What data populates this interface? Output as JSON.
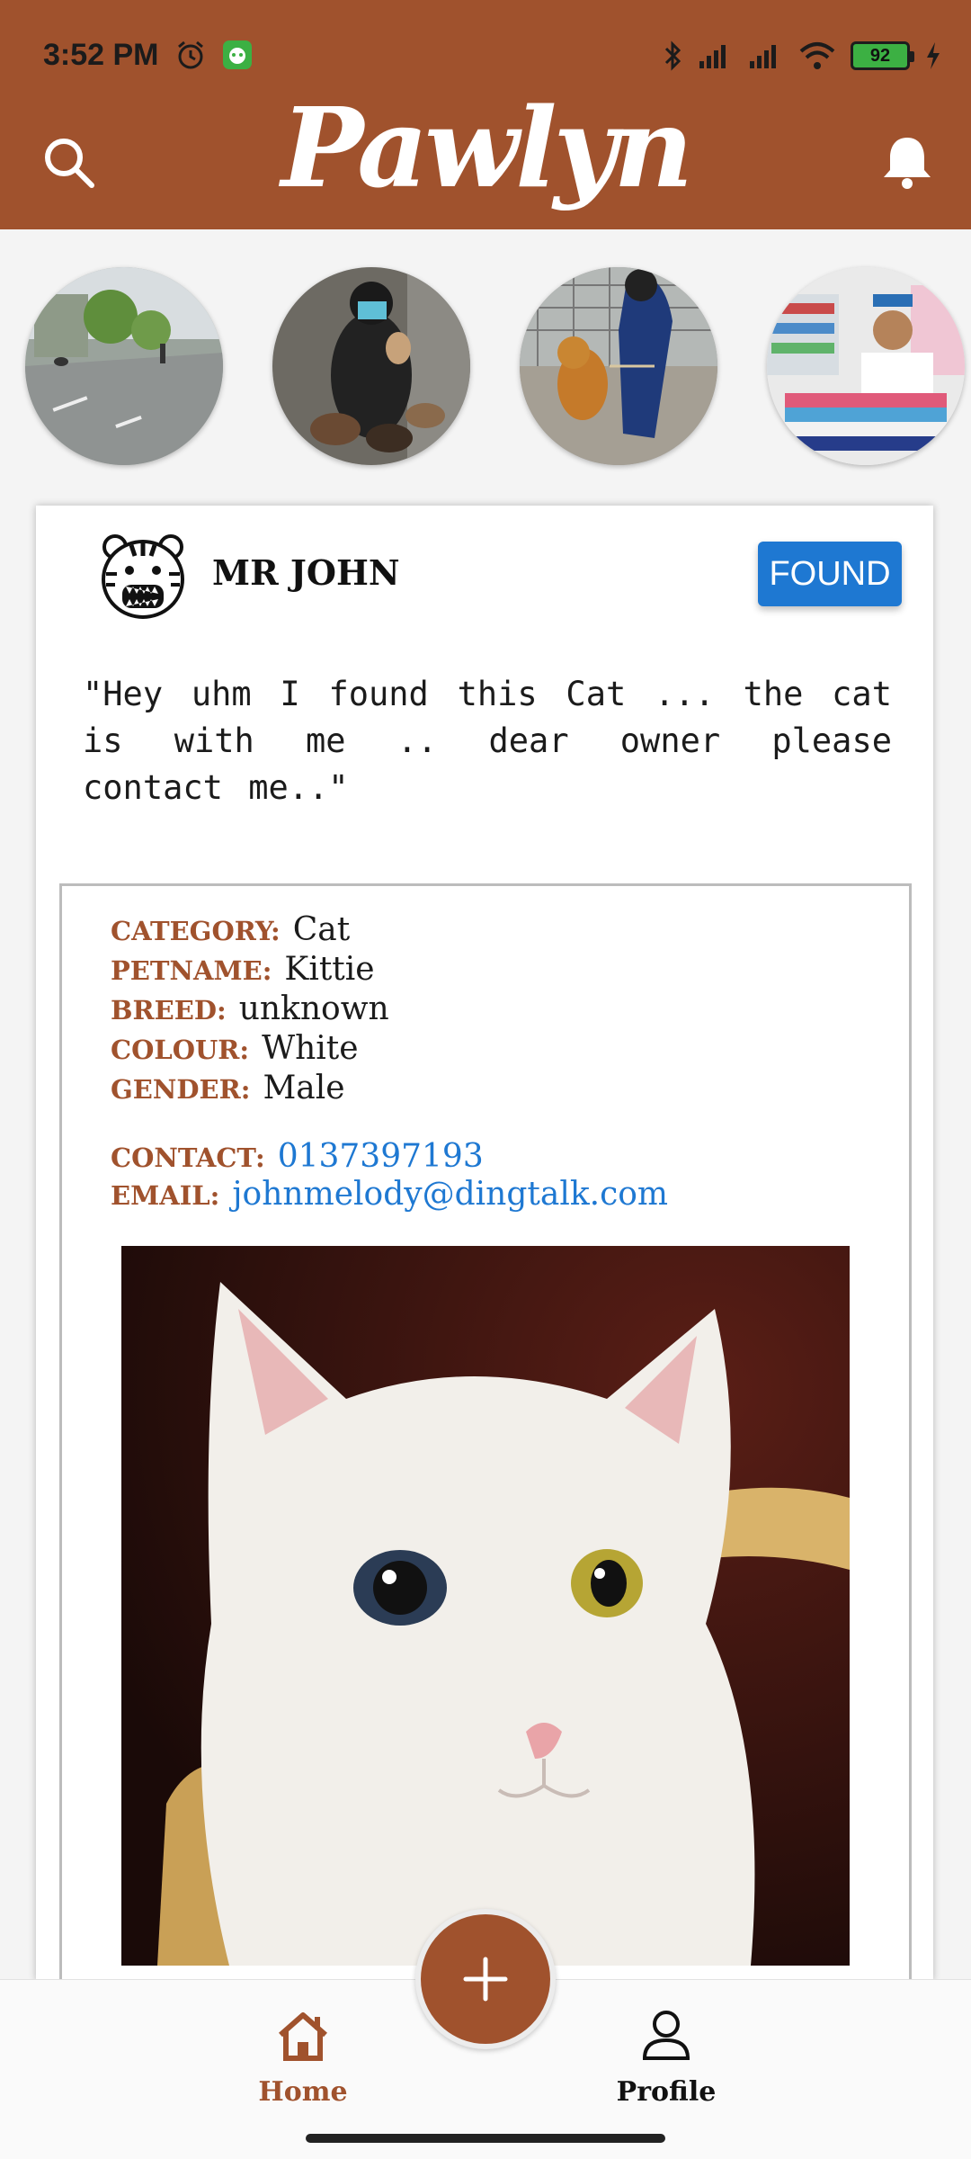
{
  "status_bar": {
    "time": "3:52 PM",
    "battery": "92",
    "icons": [
      "alarm-icon",
      "app-notification-icon",
      "bluetooth-icon",
      "signal-icon",
      "signal-icon",
      "wifi-icon",
      "battery-icon",
      "charging-icon"
    ]
  },
  "header": {
    "logo_text": "Pawlyn",
    "search_icon": "search-icon",
    "bell_icon": "bell-icon"
  },
  "stories": [
    {
      "name": "story-street-dogs"
    },
    {
      "name": "story-cat-feeding"
    },
    {
      "name": "story-dog-walking"
    },
    {
      "name": "story-pet-shop"
    }
  ],
  "post": {
    "username": "MR JOHN",
    "status_button": "FOUND",
    "text": "\"Hey uhm I found this Cat ... the cat is with me .. dear owner please contact me..\"",
    "details": [
      {
        "label": "CATEGORY:",
        "value": "Cat"
      },
      {
        "label": "PETNAME:",
        "value": "Kittie"
      },
      {
        "label": "BREED:",
        "value": "unknown"
      },
      {
        "label": "COLOUR:",
        "value": "White"
      },
      {
        "label": "GENDER:",
        "value": "Male"
      }
    ],
    "contact": {
      "label": "CONTACT:",
      "value": "0137397193"
    },
    "email": {
      "label": "EMAIL:",
      "value": "johnmelody@dingtalk.com"
    }
  },
  "bottom_nav": {
    "home_label": "Home",
    "profile_label": "Profile",
    "fab_icon": "plus-icon"
  },
  "colors": {
    "brand": "#a0522d",
    "accent_blue": "#1e78d2"
  }
}
